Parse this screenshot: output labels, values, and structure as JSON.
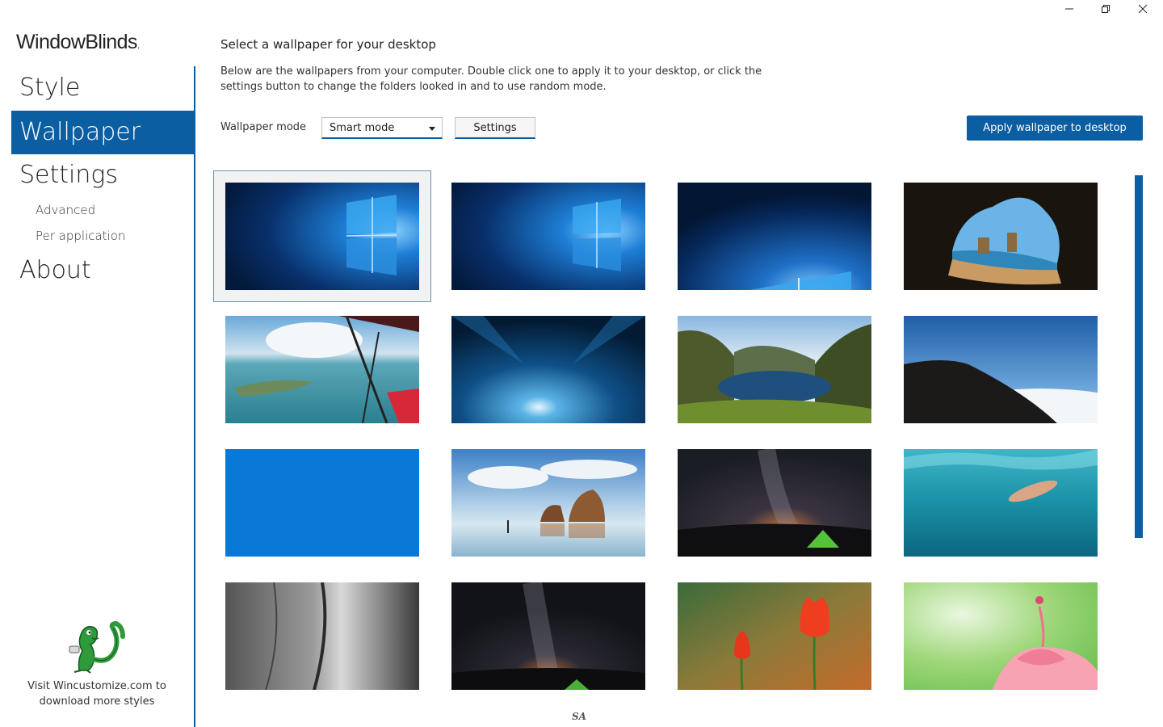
{
  "app": {
    "brand": "WindowBlinds",
    "brand_mark": "."
  },
  "nav": {
    "style": "Style",
    "wallpaper": "Wallpaper",
    "settings": "Settings",
    "advanced": "Advanced",
    "per_application": "Per application",
    "about": "About",
    "active": "Wallpaper"
  },
  "promo": {
    "text": "Visit Wincustomize.com to download more styles"
  },
  "main": {
    "heading": "Select a wallpaper for your desktop",
    "description": "Below are the wallpapers from your computer.  Double click one to apply it to your desktop, or click the settings button to change the folders looked in and to use random mode.",
    "mode_label": "Wallpaper mode",
    "mode_value": "Smart mode",
    "settings_button": "Settings",
    "apply_button": "Apply wallpaper to desktop"
  },
  "wallpapers": [
    "Windows hero blue",
    "Windows hero blue 2",
    "Windows hero blue 3",
    "Cave beach",
    "Aerial coast",
    "Ice cave",
    "Mountain lake",
    "Snowy hill",
    "Solid blue",
    "Beach rocks",
    "Milky way tent",
    "Underwater swimmer",
    "Rock face",
    "Starry night tent",
    "Red tulips",
    "Pink flower"
  ],
  "selected_wallpaper_index": 0,
  "signature": "SA",
  "colors": {
    "accent": "#0b5ea2",
    "sidebar_text": "#222222"
  }
}
